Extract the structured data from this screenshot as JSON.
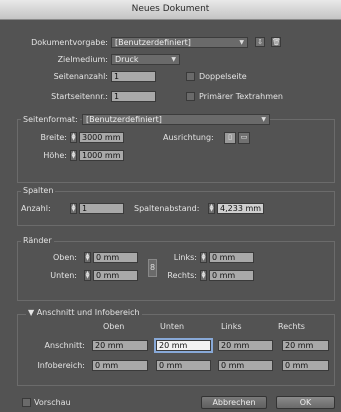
{
  "window": {
    "title": "Neues Dokument"
  },
  "preset": {
    "label": "Dokumentvorgabe:",
    "value": "[Benutzerdefiniert]"
  },
  "intent": {
    "label": "Zielmedium:",
    "value": "Druck"
  },
  "pages": {
    "label": "Seitenanzahl:",
    "value": "1",
    "facing_label": "Doppelseite"
  },
  "start": {
    "label": "Startseitennr.:",
    "value": "1",
    "primary_label": "Primärer Textrahmen"
  },
  "page_size": {
    "label": "Seitenformat:",
    "value": "[Benutzerdefiniert]"
  },
  "width": {
    "label": "Breite:",
    "value": "3000 mm"
  },
  "height": {
    "label": "Höhe:",
    "value": "1000 mm"
  },
  "orientation": {
    "label": "Ausrichtung:"
  },
  "columns": {
    "title": "Spalten",
    "count_label": "Anzahl:",
    "count_value": "1",
    "gutter_label": "Spaltenabstand:",
    "gutter_value": "4,233 mm"
  },
  "margins": {
    "title": "Ränder",
    "top_label": "Oben:",
    "top_value": "0 mm",
    "bottom_label": "Unten:",
    "bottom_value": "0 mm",
    "left_label": "Links:",
    "left_value": "0 mm",
    "right_label": "Rechts:",
    "right_value": "0 mm"
  },
  "bleed": {
    "title": "Anschnitt und Infobereich",
    "headers": [
      "Oben",
      "Unten",
      "Links",
      "Rechts"
    ],
    "bleed_label": "Anschnitt:",
    "bleed_values": [
      "20 mm",
      "20 mm",
      "20 mm",
      "20 mm"
    ],
    "slug_label": "Infobereich:",
    "slug_values": [
      "0 mm",
      "0 mm",
      "0 mm",
      "0 mm"
    ]
  },
  "footer": {
    "preview_label": "Vorschau",
    "cancel_label": "Abbrechen",
    "ok_label": "OK"
  }
}
